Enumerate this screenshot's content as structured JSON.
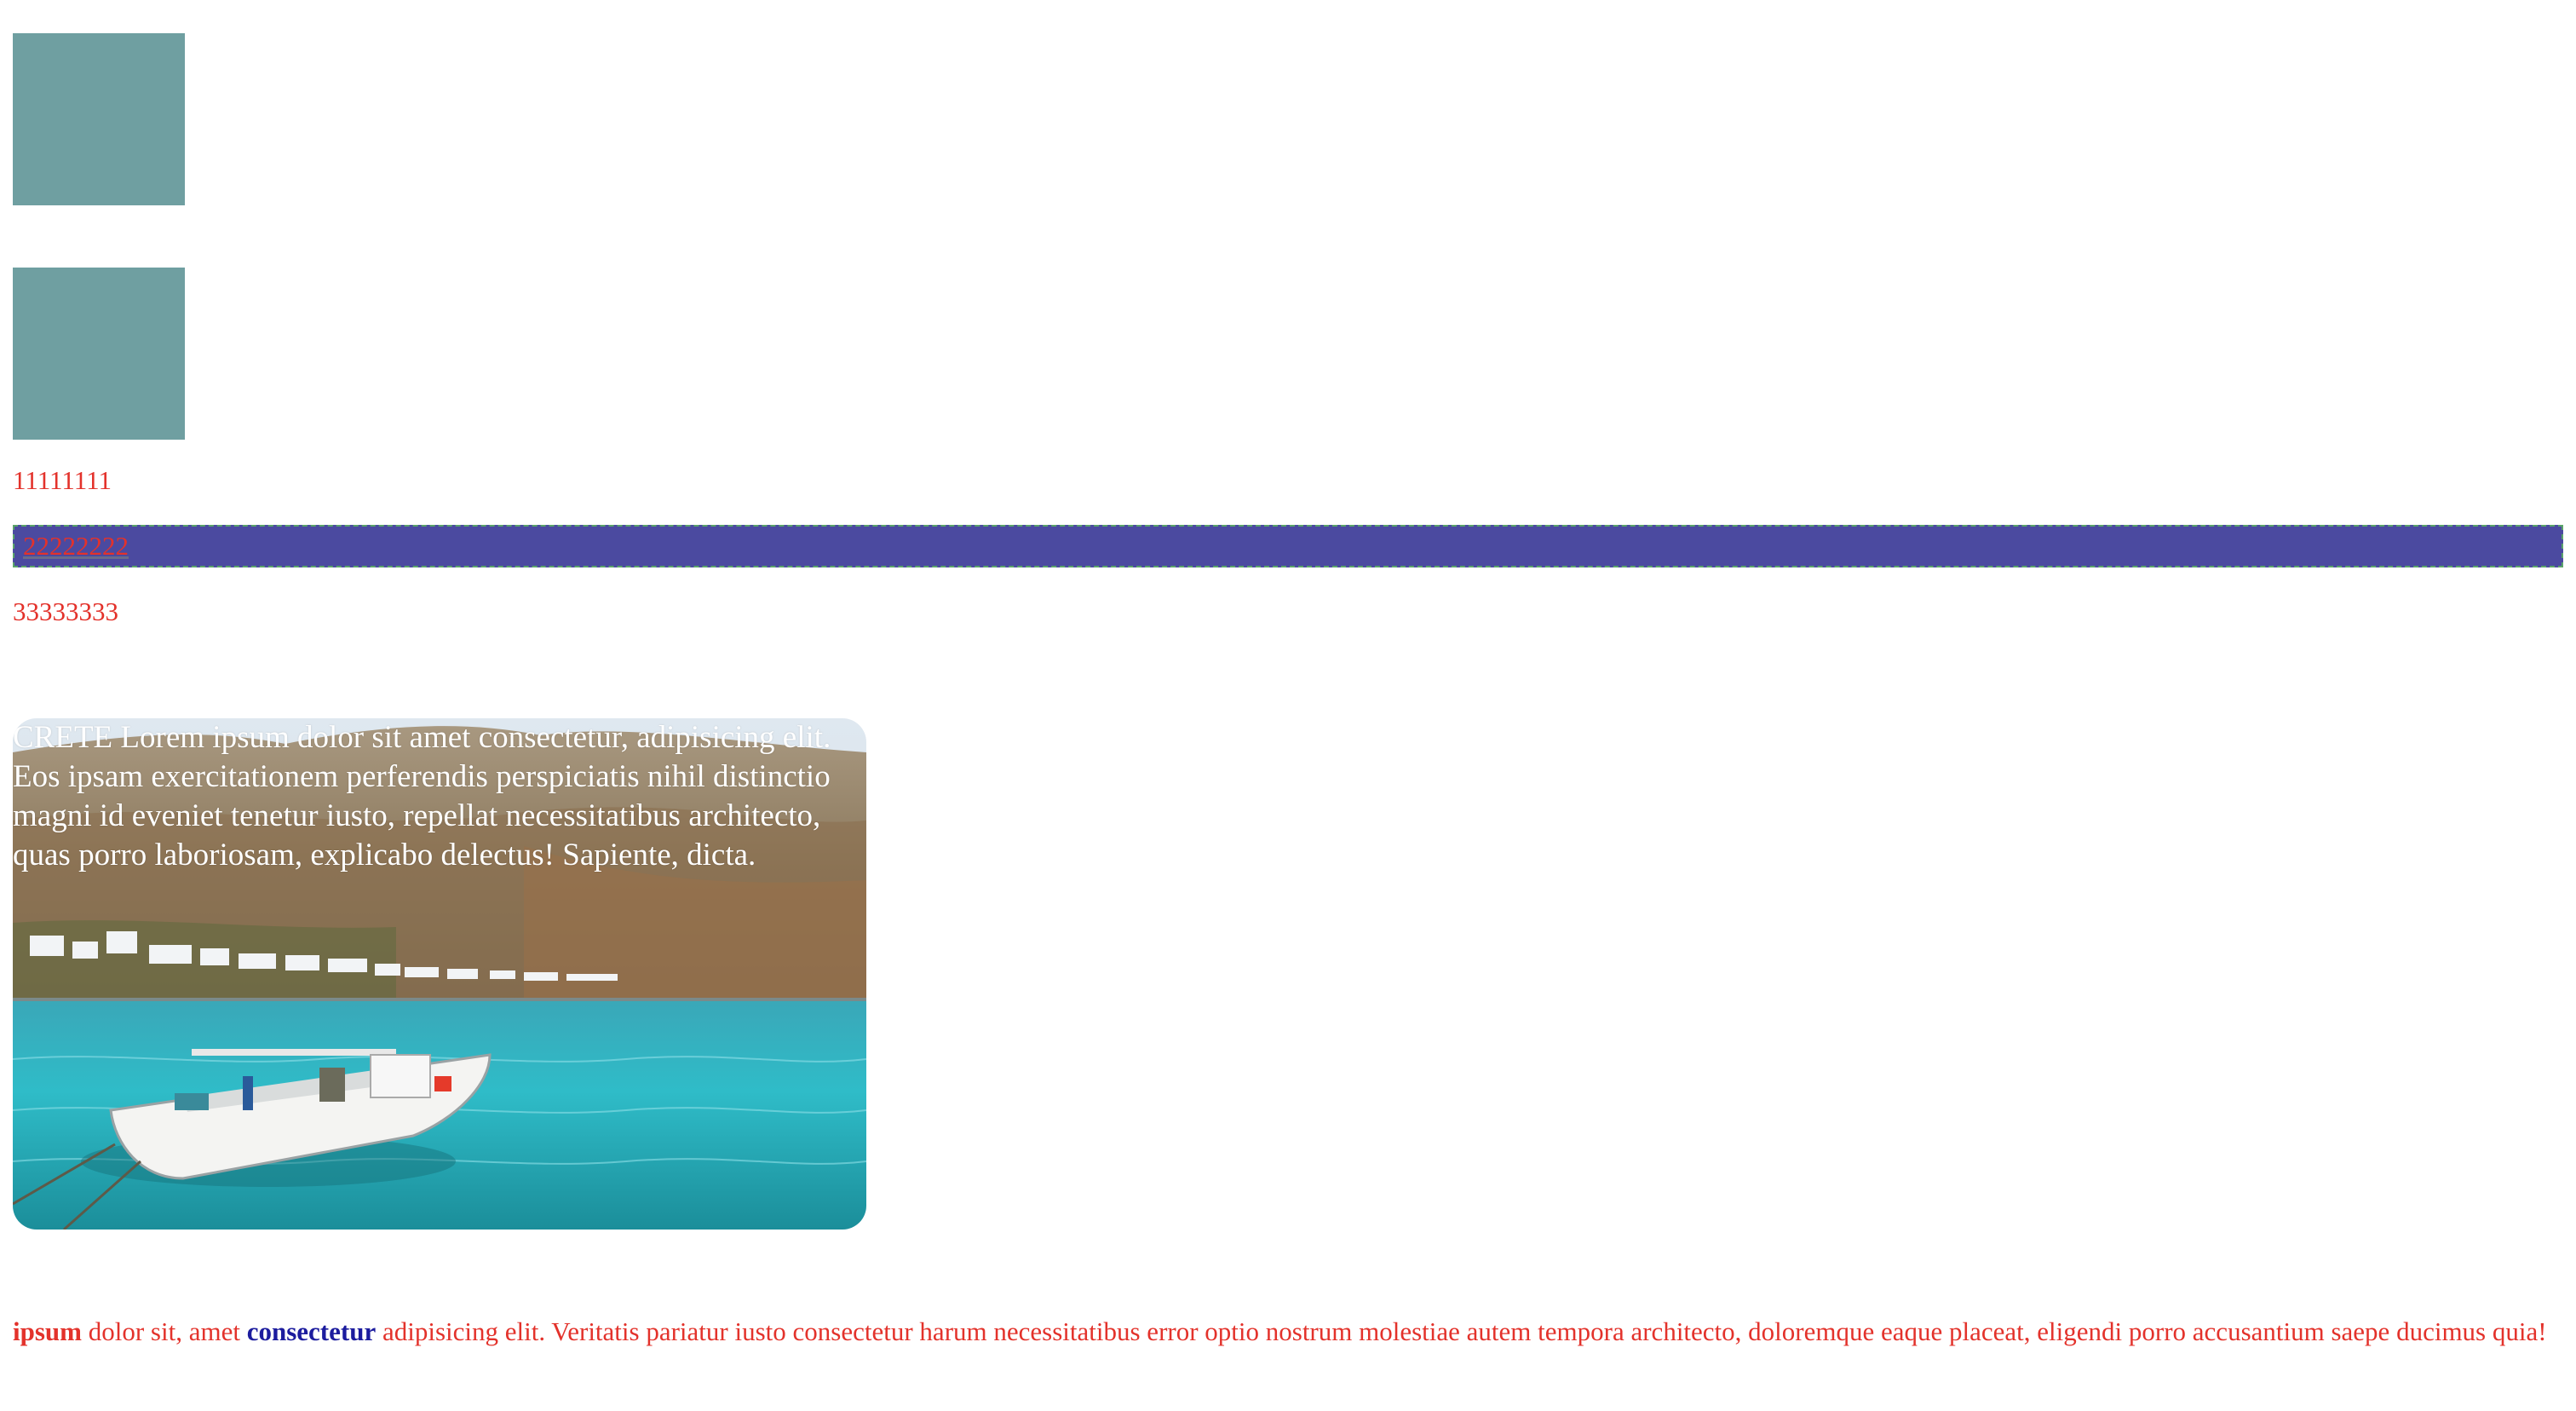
{
  "boxes": [
    {
      "color": "#6f9fa1"
    },
    {
      "color": "#6f9fa1"
    }
  ],
  "lines": {
    "first": "11111111",
    "second": "22222222",
    "third": "33333333"
  },
  "colors": {
    "text": "#e3322b",
    "bar_background": "#4b4aa0",
    "bar_border": "#5aa46a",
    "emphasis_blue": "#1c1c9e"
  },
  "card": {
    "text": "CRETE Lorem ipsum dolor sit amet consectetur, adipisicing elit. Eos ipsam exercitationem perferendis perspiciatis nihil distinctio magni id eveniet tenetur iusto, repellat necessitatibus architecto, quas porro laboriosam, explicabo delectus! Sapiente, dicta."
  },
  "paragraph": {
    "bold_1": "ipsum",
    "text_1": " dolor sit, amet ",
    "bold_2": "consectetur",
    "text_2": " adipisicing elit. Veritatis pariatur iusto consectetur harum necessitatibus error optio nostrum molestiae autem tempora architecto, doloremque eaque placeat, eligendi porro accusantium saepe ducimus quia!"
  }
}
